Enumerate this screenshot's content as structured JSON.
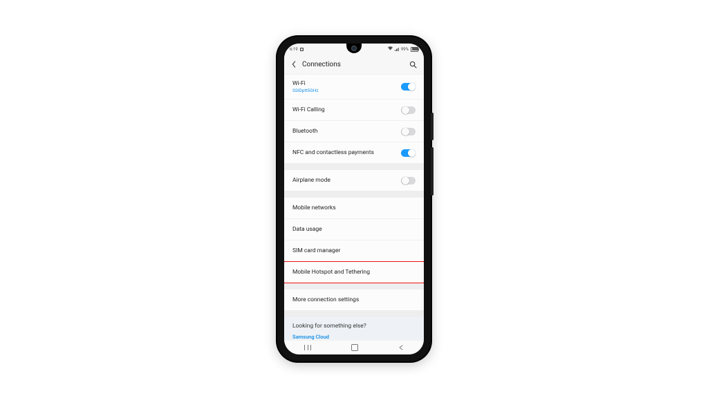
{
  "status": {
    "time": "6:19",
    "battery_pct": "99%"
  },
  "header": {
    "title": "Connections"
  },
  "rows": {
    "wifi": {
      "label": "Wi-Fi",
      "sub": "SSIDptt5GHz",
      "toggle": true
    },
    "wificalling": {
      "label": "Wi-Fi Calling",
      "toggle": false
    },
    "bluetooth": {
      "label": "Bluetooth",
      "toggle": false
    },
    "nfc": {
      "label": "NFC and contactless payments",
      "toggle": true
    },
    "airplane": {
      "label": "Airplane mode",
      "toggle": false
    },
    "mobile_net": {
      "label": "Mobile networks"
    },
    "data_usage": {
      "label": "Data usage"
    },
    "sim": {
      "label": "SIM card manager"
    },
    "hotspot": {
      "label": "Mobile Hotspot and Tethering",
      "highlighted": true
    },
    "more": {
      "label": "More connection settings"
    }
  },
  "hint": {
    "question": "Looking for something else?",
    "link": "Samsung Cloud"
  },
  "colors": {
    "accent": "#1a9bff",
    "highlight_border": "#e11"
  }
}
